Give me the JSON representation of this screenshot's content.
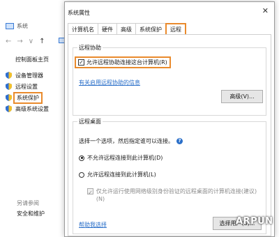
{
  "background_window": {
    "title": "系统",
    "nav": {
      "back": "←",
      "forward": "→",
      "dropdown": "∨",
      "up": "↑"
    },
    "home_link": "控制面板主页",
    "links": [
      {
        "label": "设备管理器",
        "icon": "shield-icon"
      },
      {
        "label": "远程设置",
        "icon": "shield-icon"
      },
      {
        "label": "系统保护",
        "icon": "shield-icon"
      },
      {
        "label": "高级系统设置",
        "icon": "shield-icon"
      }
    ],
    "see_also": "另请参阅",
    "security_link": "安全和维护"
  },
  "dialog": {
    "title": "系统属性",
    "close": "✕",
    "tabs": [
      "计算机名",
      "硬件",
      "高级",
      "系统保护",
      "远程"
    ],
    "active_tab": "远程",
    "remote_assistance": {
      "group_label": "远程协助",
      "checkbox_label": "允许远程协助连接这台计算机(R)",
      "checkbox_checked": "✓",
      "info_link": "有关启用远程协助的信息",
      "advanced_button": "高级(V)..."
    },
    "remote_desktop": {
      "group_label": "远程桌面",
      "description": "选择一个选项，然后指定谁可以连接。",
      "help_icon": "?",
      "option_deny": "不允许远程连接到此计算机(D)",
      "option_allow": "允许远程连接到此计算机(L)",
      "nla_checkbox_label": "仅允许运行使用网络级别身份验证的远程桌面的计算机连接(建议)(N)",
      "help_link": "帮助我选择",
      "select_users_button": "选择用户(S)..."
    }
  },
  "highlight_color": "#e98a2c",
  "link_color": "#2a6fc9",
  "watermark": "ARPUN"
}
